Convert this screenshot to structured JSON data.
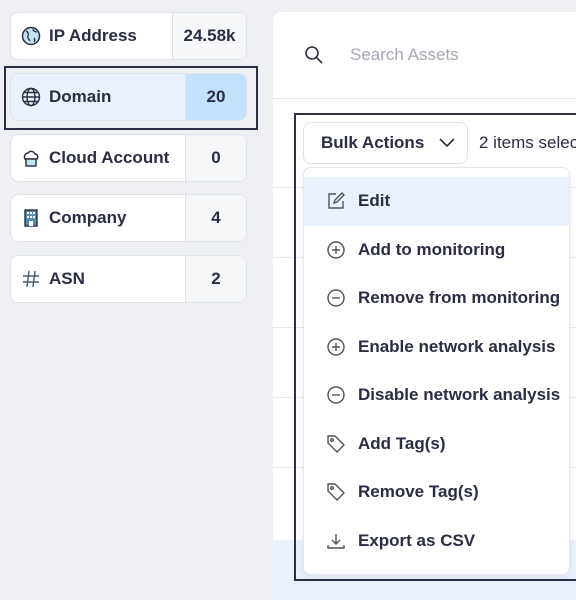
{
  "asset_types": [
    {
      "label": "IP Address",
      "count": "24.58k",
      "icon": "globe-earth-icon"
    },
    {
      "label": "Domain",
      "count": "20",
      "icon": "globe-icon",
      "selected": true
    },
    {
      "label": "Cloud Account",
      "count": "0",
      "icon": "cloud-icon"
    },
    {
      "label": "Company",
      "count": "4",
      "icon": "building-icon"
    },
    {
      "label": "ASN",
      "count": "2",
      "icon": "hash-icon"
    }
  ],
  "search": {
    "placeholder": "Search Assets"
  },
  "bulk_actions": {
    "label": "Bulk Actions",
    "selection_text": "2 items selec"
  },
  "menu": [
    {
      "label": "Edit",
      "icon": "edit-icon"
    },
    {
      "label": "Add to monitoring",
      "icon": "plus-circle-icon"
    },
    {
      "label": "Remove from monitoring",
      "icon": "minus-circle-icon"
    },
    {
      "label": "Enable network analysis",
      "icon": "plus-circle-icon"
    },
    {
      "label": "Disable network analysis",
      "icon": "minus-circle-icon"
    },
    {
      "label": "Add Tag(s)",
      "icon": "tag-icon"
    },
    {
      "label": "Remove Tag(s)",
      "icon": "tag-icon"
    },
    {
      "label": "Export as CSV",
      "icon": "download-icon"
    }
  ],
  "colors": {
    "accent": "#c5e0fa",
    "selected_bg": "#eaf3fd",
    "outline": "#2d2f45"
  }
}
